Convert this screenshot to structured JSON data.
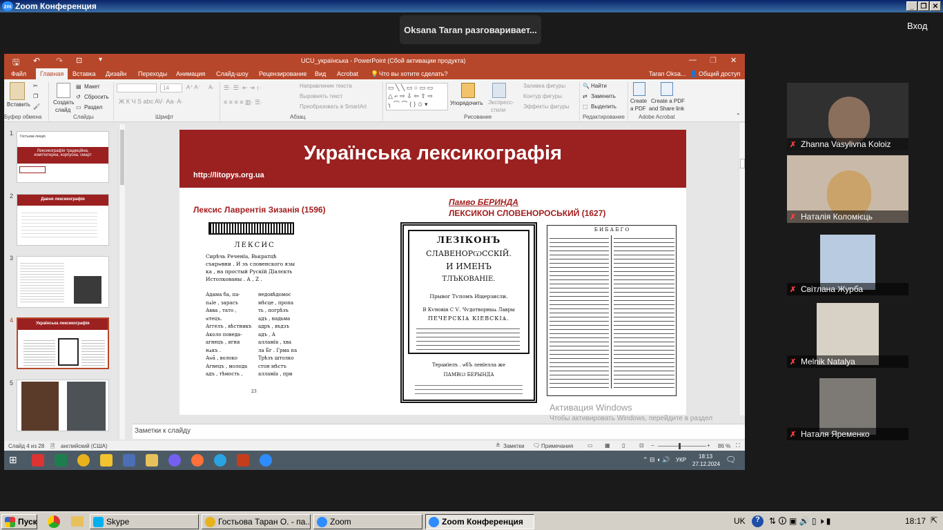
{
  "zoom": {
    "window_title": "Zoom Конференция",
    "speaker_banner": "Oksana Taran разговаривает...",
    "enter_label": "Вход",
    "participants": [
      {
        "name": "Zhanna Vasylivna Koloiz"
      },
      {
        "name": "Наталія Коломієць"
      },
      {
        "name": "Світлана Журба"
      },
      {
        "name": "Melnik Natalya"
      },
      {
        "name": "Наталя Яременко"
      }
    ]
  },
  "ppt": {
    "title": "UCU_українська - PowerPoint (Сбой активации продукта)",
    "user": "Taran Oksa...",
    "share": "Общий доступ",
    "tabs": [
      "Файл",
      "Главная",
      "Вставка",
      "Дизайн",
      "Переходы",
      "Анимация",
      "Слайд-шоу",
      "Рецензирование",
      "Вид",
      "Acrobat"
    ],
    "tell_me": "Что вы хотите сделать?",
    "ribbon": {
      "paste": "Вставить",
      "clipboard": "Буфер обмена",
      "create_slide_1": "Создать",
      "create_slide_2": "слайд",
      "layout": "Макет",
      "reset": "Сбросить",
      "section": "Раздел",
      "slides": "Слайды",
      "font_size": "14",
      "font": "Шрифт",
      "text_dir": "Направление текста",
      "align_text": "Выровнять текст",
      "smartart": "Преобразовать в SmartArt",
      "paragraph": "Абзац",
      "arrange": "Упорядочить",
      "express_1": "Экспресс-",
      "express_2": "стили",
      "fill": "Заливка фигуры",
      "outline": "Контур фигуры",
      "effects": "Эффекты фигуры",
      "drawing": "Рисование",
      "find": "Найти",
      "replace": "Заменить",
      "select": "Выделить",
      "editing": "Редактирование",
      "create_pdf_1": "Create",
      "create_pdf_2": "a PDF",
      "create_share_1": "Create a PDF",
      "create_share_2": "and Share link",
      "adobe": "Adobe Acrobat"
    },
    "thumbnails": [
      {
        "num": "1",
        "title": "Лексикографія традиційна, комп'ютерна, корпусна, смарт",
        "header": "Гостьова лекція"
      },
      {
        "num": "2",
        "title": "Давня лексикографія"
      },
      {
        "num": "3"
      },
      {
        "num": "4",
        "title": "Українська лексикографія"
      },
      {
        "num": "5"
      }
    ],
    "slide": {
      "title": "Українська лексикографія",
      "url": "http://litopys.org.ua",
      "left_caption": "Лексис Лаврентія Зизанія (1596)",
      "right_caption_1": "Памво БЕРИНДА",
      "right_caption_2": "ЛЕКСИКОН СЛОВЕНОРОСЬКИЙ (1627)",
      "left_page_head": "ЛЕКСИС",
      "left_page_lines": [
        "Сирѣчь Реченїа, Вькратцѣ",
        "съкрѡвни . И зъ словенского язы",
        "ка , на простый Рускїй Дїалєкть",
        "Истолкованы . А , Z ."
      ],
      "left_col1": [
        "Адама ба, па-",
        "пѧїе , зарасъ",
        "Авва , тато ,",
        "ѡтецъ.",
        "Аггелъ , вѣстникъ",
        "Аколо поведа-",
        "агнецъ , ягня",
        "нѧкъ .",
        "Аѡӑ , волоко",
        "Агнецъ , молода",
        "адъ , тѣмость ,"
      ],
      "left_col2": [
        "недовѣдомос",
        "мѣсце , пропа",
        "ть , погрѣзъ",
        "адъ , надьма",
        "адръ , въдзъ",
        "адъ , А",
        "алламїя , хва",
        "ла Бг . Грма па",
        "Трѣзъ штолко",
        "стон мѣстъ",
        "алламїа , при"
      ],
      "left_page_num": "23",
      "right_book": {
        "line1": "ЛЕЗІКОНЪ",
        "line2": "СЛАВЕНОРѠССКІЙ.",
        "line3": "И ИМЕНЪ",
        "line4": "ТЛЪКОВАНІЕ.",
        "line5": "Прывог Тѵпомъ Ищерзисли.",
        "line6": "В Кѵновіи С Ѵ. Чѵдотворныѧ Лавры",
        "line7": "ПЕЧЕРСКІѦ КІЕВСКІѦ.",
        "line8": "Тераиїелъ . ѡбЪ ленїелла же",
        "line9": "ПАМВѠ БЕРЫНДА"
      },
      "dict_header": "Б  И  Б  А  Б  Г  О"
    },
    "watermark_title": "Активация Windows",
    "watermark_sub": "Чтобы активировать Windows, перейдите в раздел \"Параметры\".",
    "notes": "Заметки к слайду",
    "status_slide": "Слайд 4 из 28",
    "status_lang": "английский (США)",
    "status_notes": "Заметки",
    "status_comments": "Примечания",
    "zoom_pct": "86 %"
  },
  "remote_taskbar": {
    "lang": "УКР",
    "time": "18:13",
    "date": "27.12.2024"
  },
  "xp_taskbar": {
    "start": "Пуск",
    "items": [
      "Skype",
      "Гостьова Таран О. - па...",
      "Zoom",
      "Zoom Конференция"
    ],
    "lang": "UK",
    "time": "18:17"
  }
}
